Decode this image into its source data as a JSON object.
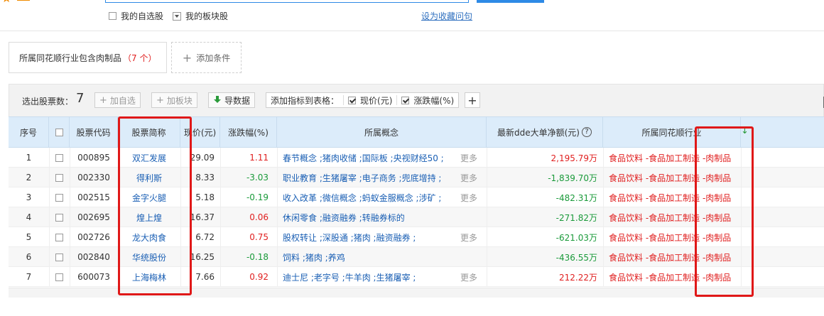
{
  "header": {
    "my_watchlist_label": "我的自选股",
    "my_sector_label": "我的板块股",
    "favorite_link": "设为收藏问句"
  },
  "condition": {
    "text": "所属同花顺行业包含肉制品",
    "count": "（7 个）",
    "add_label": "添加条件"
  },
  "toolbar": {
    "selected_label": "选出股票数：",
    "selected_count": "7",
    "add_watch": "加自选",
    "add_block": "加板块",
    "export": "导数据",
    "add_indicator_label": "添加指标到表格：",
    "ind_price": "现价(元)",
    "ind_change": "涨跌幅(%)",
    "plus": "+"
  },
  "table": {
    "headers": {
      "seq": "序号",
      "code": "股票代码",
      "name": "股票简称",
      "price": "现价(元)",
      "change": "涨跌幅(%)",
      "concept": "所属概念",
      "dde": "最新dde大单净额(元)",
      "industry": "所属同花顺行业",
      "sort_arrow": "↓"
    },
    "more_label": "更多",
    "rows": [
      {
        "seq": "1",
        "code": "000895",
        "name": "双汇发展",
        "price": "29.09",
        "change": "1.11",
        "dir": "up",
        "concept": "春节概念 ;猪肉收储 ;国际板 ;央视财经50 ;",
        "more": true,
        "dde": "2,195.79万",
        "industry": "食品饮料 -食品加工制造 -肉制品"
      },
      {
        "seq": "2",
        "code": "002330",
        "name": "得利斯",
        "price": "8.33",
        "change": "-3.03",
        "dir": "down",
        "concept": "职业教育 ;生猪屠宰 ;电子商务 ;兜底增持 ;",
        "more": true,
        "dde": "-1,839.70万",
        "industry": "食品饮料 -食品加工制造 -肉制品"
      },
      {
        "seq": "3",
        "code": "002515",
        "name": "金字火腿",
        "price": "5.18",
        "change": "-0.19",
        "dir": "down",
        "concept": "收入改革 ;微信概念 ;蚂蚁金服概念 ;涉矿 ;",
        "more": true,
        "dde": "-482.31万",
        "industry": "食品饮料 -食品加工制造 -肉制品"
      },
      {
        "seq": "4",
        "code": "002695",
        "name": "煌上煌",
        "price": "16.37",
        "change": "0.06",
        "dir": "up",
        "concept": "休闲零食 ;融资融券 ;转融券标的",
        "more": false,
        "dde": "-271.82万",
        "industry": "食品饮料 -食品加工制造 -肉制品"
      },
      {
        "seq": "5",
        "code": "002726",
        "name": "龙大肉食",
        "price": "6.72",
        "change": "0.75",
        "dir": "up",
        "concept": "股权转让 ;深股通 ;猪肉 ;融资融券 ;",
        "more": true,
        "dde": "-621.03万",
        "industry": "食品饮料 -食品加工制造 -肉制品"
      },
      {
        "seq": "6",
        "code": "002840",
        "name": "华统股份",
        "price": "16.25",
        "change": "-0.18",
        "dir": "down",
        "concept": "饲料 ;猪肉 ;养鸡",
        "more": false,
        "dde": "-436.55万",
        "industry": "食品饮料 -食品加工制造 -肉制品"
      },
      {
        "seq": "7",
        "code": "600073",
        "name": "上海梅林",
        "price": "7.66",
        "change": "0.92",
        "dir": "up",
        "concept": "迪士尼 ;老字号 ;牛羊肉 ;生猪屠宰 ;",
        "more": true,
        "dde": "212.22万",
        "industry": "食品饮料 -食品加工制造 -肉制品"
      }
    ]
  },
  "colors": {
    "accent": "#2e8ae6",
    "up": "#e02020",
    "down": "#1a9a3a",
    "link": "#1a5fb4",
    "annotation": "#e01818"
  }
}
